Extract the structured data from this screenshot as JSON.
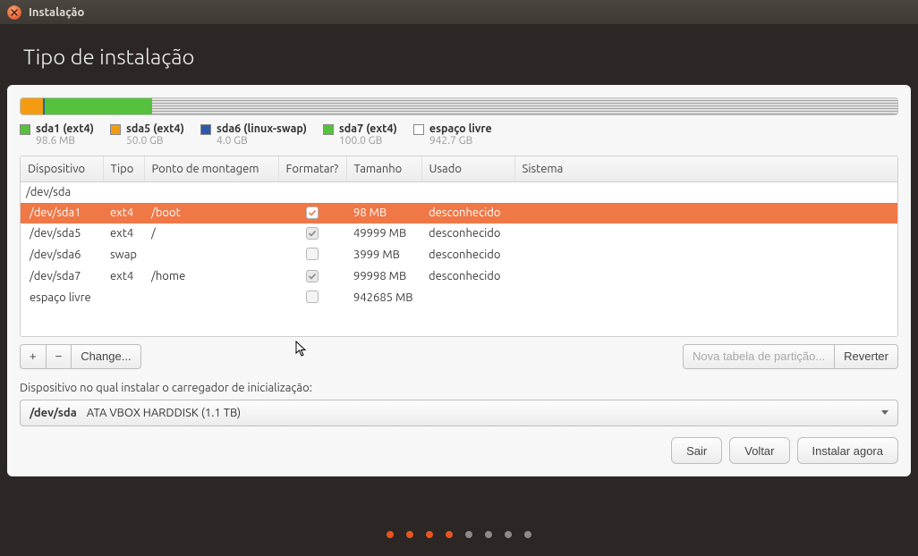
{
  "window": {
    "title": "Instalação"
  },
  "header": {
    "title": "Tipo de instalação"
  },
  "disk": {
    "segments": [
      {
        "color": "#f39c12",
        "percent": 2.5
      },
      {
        "color": "#55c13c",
        "percent": 1.0,
        "border": "#1a6b8f"
      },
      {
        "color": "#55c13c",
        "percent": 4.0
      },
      {
        "color": "#55c13c",
        "percent": 5.0
      },
      {
        "color": "#55c13c",
        "percent": 2.5
      },
      {
        "hatch": true,
        "percent": 85.0
      }
    ]
  },
  "legend": [
    {
      "swatch": "#55c13c",
      "label": "sda1 (ext4)",
      "sub": "98.6 MB"
    },
    {
      "swatch": "#f39c12",
      "label": "sda5 (ext4)",
      "sub": "50.0 GB"
    },
    {
      "swatch": "#2e5aac",
      "label": "sda6 (linux-swap)",
      "sub": "4.0 GB"
    },
    {
      "swatch": "#55c13c",
      "label": "sda7 (ext4)",
      "sub": "100.0 GB"
    },
    {
      "swatch": "#ffffff",
      "label": "espaço livre",
      "sub": "942.7 GB"
    }
  ],
  "table": {
    "headers": [
      "Dispositivo",
      "Tipo",
      "Ponto de montagem",
      "Formatar?",
      "Tamanho",
      "Usado",
      "Sistema"
    ],
    "parent": "/dev/sda",
    "rows": [
      {
        "device": "/dev/sda1",
        "type": "ext4",
        "mount": "/boot",
        "format": true,
        "size": "98 MB",
        "used": "desconhecido",
        "selected": true
      },
      {
        "device": "/dev/sda5",
        "type": "ext4",
        "mount": "/",
        "format": true,
        "size": "49999 MB",
        "used": "desconhecido"
      },
      {
        "device": "/dev/sda6",
        "type": "swap",
        "mount": "",
        "format": false,
        "size": "3999 MB",
        "used": "desconhecido"
      },
      {
        "device": "/dev/sda7",
        "type": "ext4",
        "mount": "/home",
        "format": true,
        "size": "99998 MB",
        "used": "desconhecido"
      },
      {
        "device": "espaço livre",
        "type": "",
        "mount": "",
        "format": false,
        "size": "942685 MB",
        "used": ""
      }
    ]
  },
  "toolbar": {
    "add": "+",
    "remove": "−",
    "change": "Change...",
    "new_table": "Nova tabela de partição...",
    "revert": "Reverter"
  },
  "bootloader": {
    "label": "Dispositivo no qual instalar o carregador de inicialização:",
    "disk": "/dev/sda",
    "desc": "ATA VBOX HARDDISK (1.1 TB)"
  },
  "footer": {
    "quit": "Sair",
    "back": "Voltar",
    "install": "Instalar agora"
  },
  "progress": {
    "total": 8,
    "current": 4
  }
}
